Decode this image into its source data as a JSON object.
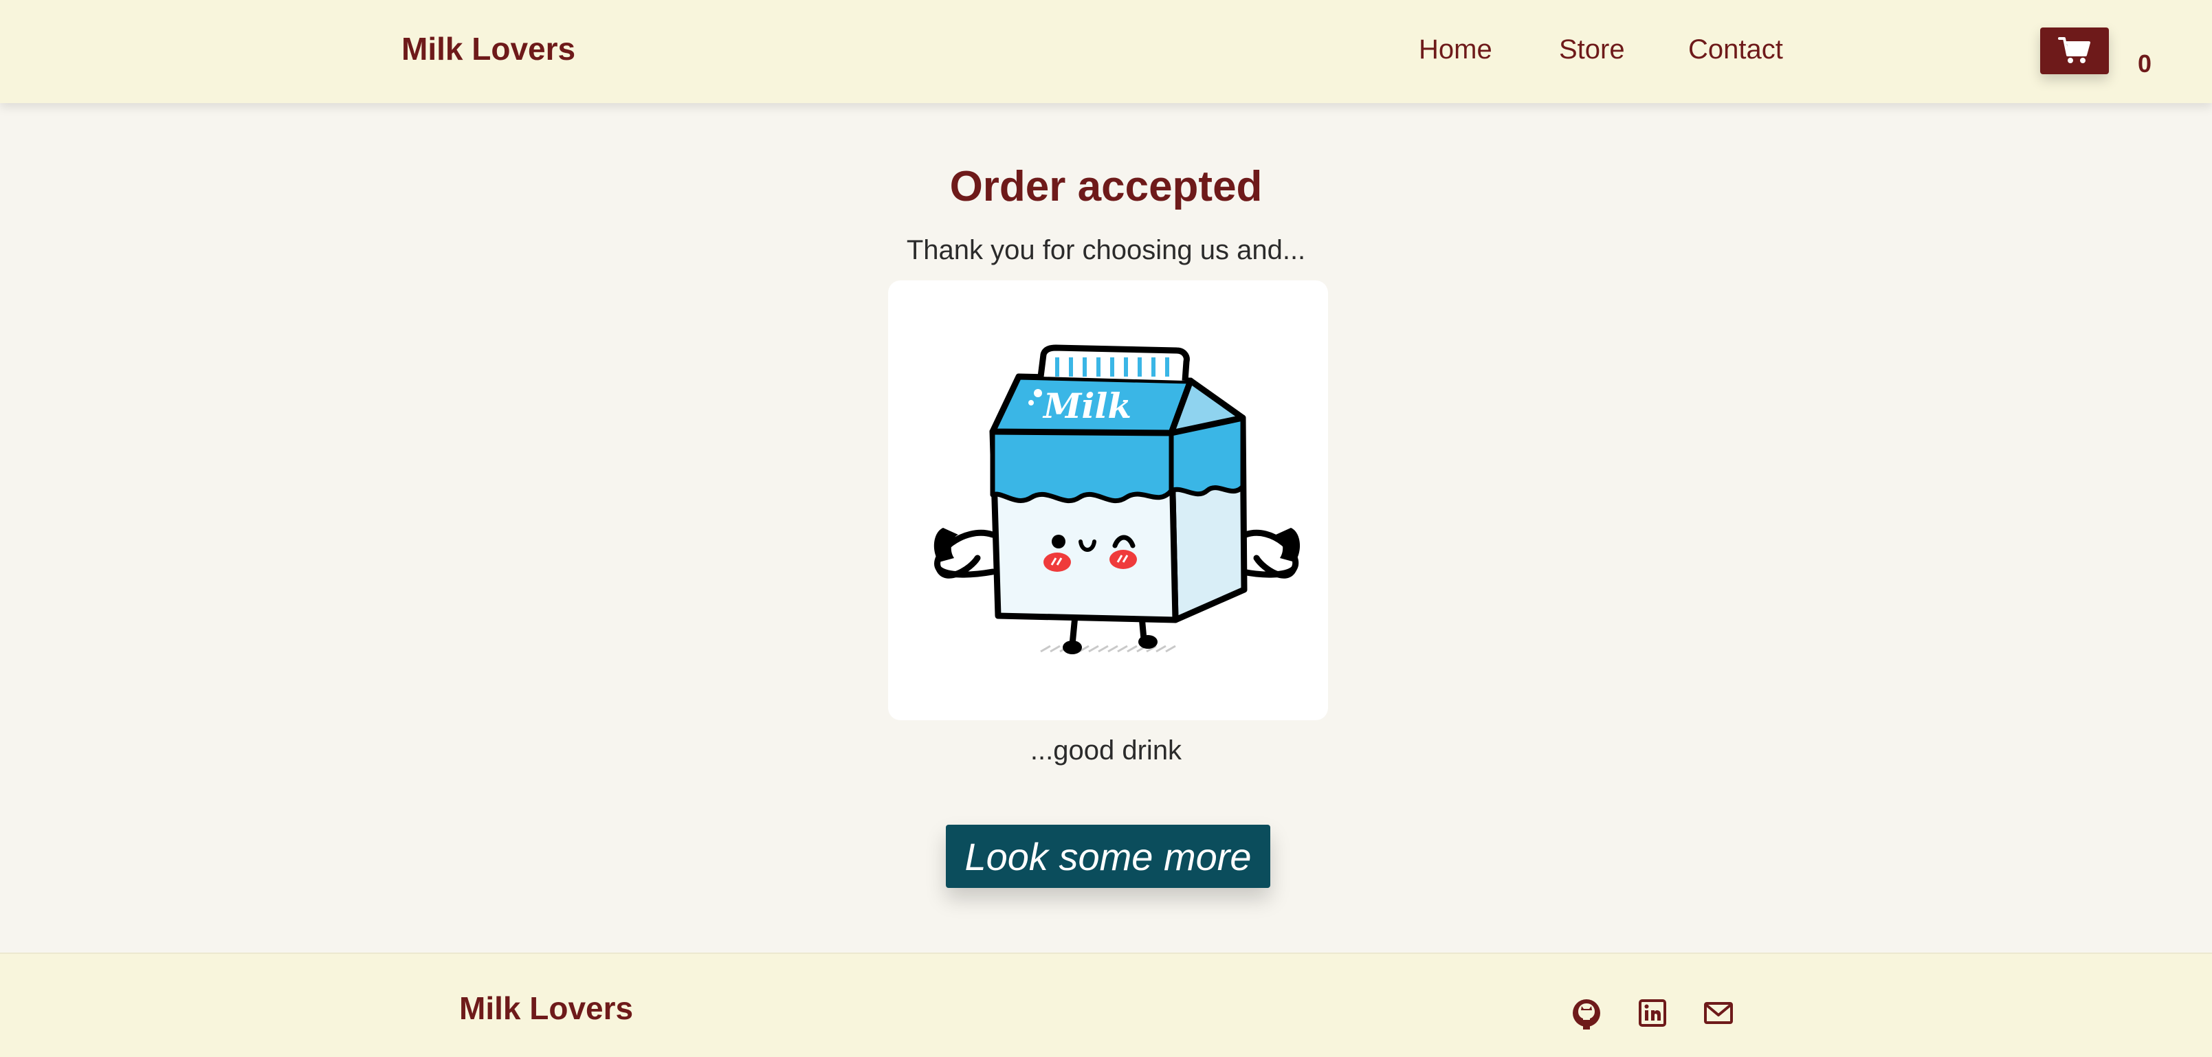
{
  "header": {
    "brand": "Milk Lovers",
    "nav": {
      "home": "Home",
      "store": "Store",
      "contact": "Contact"
    },
    "cart": {
      "icon": "cart-icon",
      "count": "0"
    }
  },
  "main": {
    "title": "Order accepted",
    "subtitle": "Thank you for choosing us and...",
    "image": {
      "kind": "milk-carton-mascot-illustration",
      "carton_label": "Milk"
    },
    "caption": "...good drink",
    "cta_label": "Look some more"
  },
  "footer": {
    "brand": "Milk Lovers",
    "icons": [
      "github-icon",
      "linkedin-icon",
      "mail-icon"
    ]
  },
  "colors": {
    "brand": "#6e1a1a",
    "header_bg": "#f8f5dc",
    "page_bg": "#f7f5ef",
    "cta_bg": "#0b4d5c",
    "carton_blue": "#3ab6e6"
  }
}
